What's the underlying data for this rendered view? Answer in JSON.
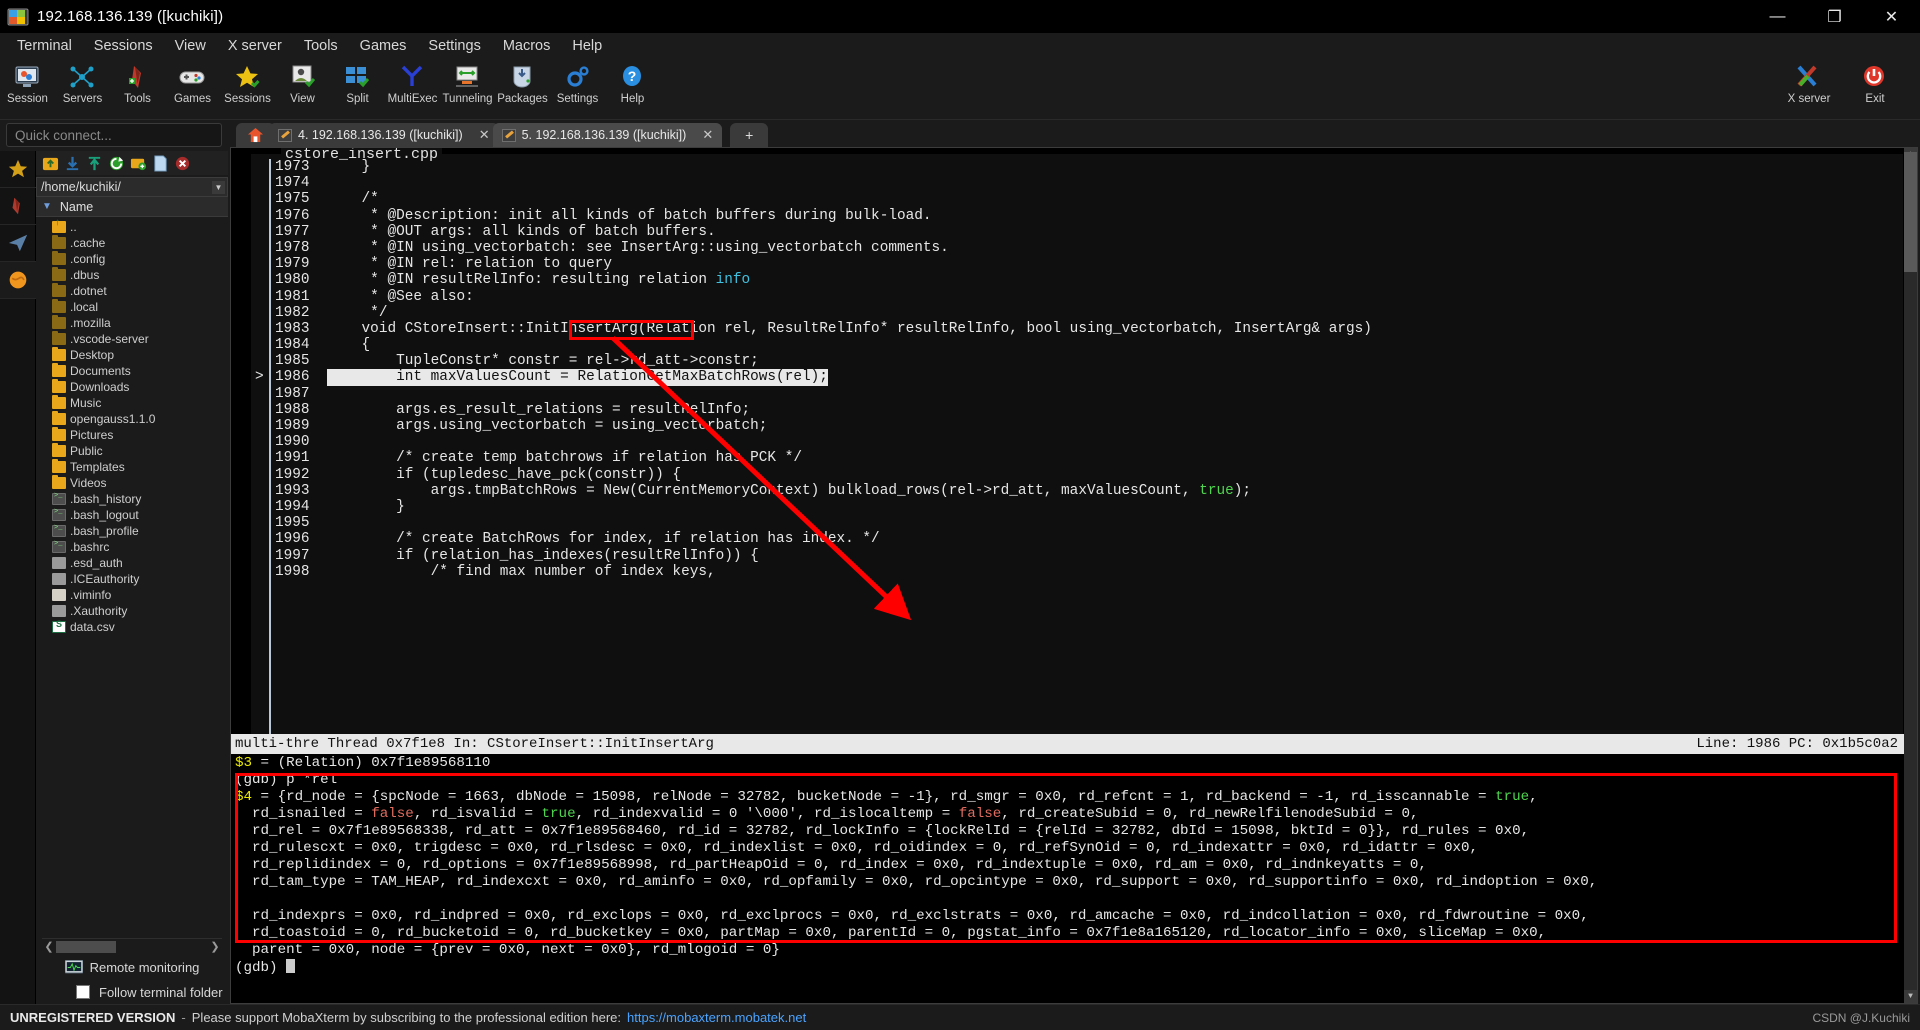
{
  "window": {
    "title": "192.168.136.139 ([kuchiki])",
    "app_icon": "mobaxterm-icon",
    "minimize": "—",
    "maximize": "❐",
    "close": "✕"
  },
  "menubar": [
    "Terminal",
    "Sessions",
    "View",
    "X server",
    "Tools",
    "Games",
    "Settings",
    "Macros",
    "Help"
  ],
  "toolbar": {
    "left": [
      {
        "label": "Session",
        "icon": "session-icon"
      },
      {
        "label": "Servers",
        "icon": "servers-icon"
      },
      {
        "label": "Tools",
        "icon": "tools-icon"
      },
      {
        "label": "Games",
        "icon": "games-icon"
      },
      {
        "label": "Sessions",
        "icon": "sessions-star-icon"
      },
      {
        "label": "View",
        "icon": "view-icon"
      },
      {
        "label": "Split",
        "icon": "split-icon"
      },
      {
        "label": "MultiExec",
        "icon": "multiexec-icon"
      },
      {
        "label": "Tunneling",
        "icon": "tunneling-icon"
      },
      {
        "label": "Packages",
        "icon": "packages-icon"
      },
      {
        "label": "Settings",
        "icon": "settings-gear-icon"
      },
      {
        "label": "Help",
        "icon": "help-icon"
      }
    ],
    "right": [
      {
        "label": "X server",
        "icon": "x-server-icon"
      },
      {
        "label": "Exit",
        "icon": "power-exit-icon"
      }
    ]
  },
  "sidebar": {
    "quick_connect_placeholder": "Quick connect...",
    "vertical_tabs": [
      "favorites-star-icon",
      "tools-knife-icon",
      "sftp-plane-icon",
      "macros-globe-icon"
    ],
    "file_tools": [
      "parent-folder-icon",
      "download-icon",
      "upload-icon",
      "refresh-icon",
      "new-folder-icon",
      "new-file-icon",
      "delete-icon"
    ],
    "path": "/home/kuchiki/",
    "column_header": "Name",
    "sort_icon": "sort-desc-icon",
    "files": [
      {
        "name": "..",
        "kind": "up"
      },
      {
        "name": ".cache",
        "kind": "folder-dim"
      },
      {
        "name": ".config",
        "kind": "folder-dim"
      },
      {
        "name": ".dbus",
        "kind": "folder-dim"
      },
      {
        "name": ".dotnet",
        "kind": "folder-dim"
      },
      {
        "name": ".local",
        "kind": "folder-dim"
      },
      {
        "name": ".mozilla",
        "kind": "folder-dim"
      },
      {
        "name": ".vscode-server",
        "kind": "folder-dim"
      },
      {
        "name": "Desktop",
        "kind": "folder"
      },
      {
        "name": "Documents",
        "kind": "folder"
      },
      {
        "name": "Downloads",
        "kind": "folder"
      },
      {
        "name": "Music",
        "kind": "folder"
      },
      {
        "name": "opengauss1.1.0",
        "kind": "folder"
      },
      {
        "name": "Pictures",
        "kind": "folder"
      },
      {
        "name": "Public",
        "kind": "folder"
      },
      {
        "name": "Templates",
        "kind": "folder"
      },
      {
        "name": "Videos",
        "kind": "folder"
      },
      {
        "name": ".bash_history",
        "kind": "term"
      },
      {
        "name": ".bash_logout",
        "kind": "term"
      },
      {
        "name": ".bash_profile",
        "kind": "term"
      },
      {
        "name": ".bashrc",
        "kind": "term"
      },
      {
        "name": ".esd_auth",
        "kind": "doc"
      },
      {
        "name": ".ICEauthority",
        "kind": "doc"
      },
      {
        "name": ".viminfo",
        "kind": "viminfo"
      },
      {
        "name": ".Xauthority",
        "kind": "doc"
      },
      {
        "name": "data.csv",
        "kind": "csv"
      }
    ],
    "remote_monitoring": "Remote monitoring",
    "follow_terminal_folder": "Follow terminal folder",
    "follow_checked": false
  },
  "tabs": {
    "home_icon": "home-icon",
    "items": [
      {
        "label": "4. 192.168.136.139 ([kuchiki])",
        "active": false,
        "close": "✕"
      },
      {
        "label": "5. 192.168.136.139 ([kuchiki])",
        "active": true,
        "close": "✕"
      }
    ],
    "new_tab": "+"
  },
  "editor": {
    "filename": "cstore_insert.cpp",
    "current_line": 1986,
    "lines": [
      {
        "n": "1973",
        "text": "    }"
      },
      {
        "n": "1974",
        "text": ""
      },
      {
        "n": "1975",
        "text": "    /*"
      },
      {
        "n": "1976",
        "text": "     * @Description: init all kinds of batch buffers during bulk-load."
      },
      {
        "n": "1977",
        "text": "     * @OUT args: all kinds of batch buffers."
      },
      {
        "n": "1978",
        "text": "     * @IN using_vectorbatch: see InsertArg::using_vectorbatch comments."
      },
      {
        "n": "1979",
        "text": "     * @IN rel: relation to query"
      },
      {
        "n": "1980",
        "text": "     * @IN resultRelInfo: resulting relation info",
        "hl": "info"
      },
      {
        "n": "1981",
        "text": "     * @See also:"
      },
      {
        "n": "1982",
        "text": "     */"
      },
      {
        "n": "1983",
        "text": "    void CStoreInsert::InitInsertArg(Relation rel, ResultRelInfo* resultRelInfo, bool using_vectorbatch, InsertArg& args)"
      },
      {
        "n": "1984",
        "text": "    {"
      },
      {
        "n": "1985",
        "text": "        TupleConstr* constr = rel->rd_att->constr;"
      },
      {
        "n": "1986",
        "text": "        int maxValuesCount = RelationGetMaxBatchRows(rel);",
        "current": true
      },
      {
        "n": "1987",
        "text": ""
      },
      {
        "n": "1988",
        "text": "        args.es_result_relations = resultRelInfo;"
      },
      {
        "n": "1989",
        "text": "        args.using_vectorbatch = using_vectorbatch;"
      },
      {
        "n": "1990",
        "text": ""
      },
      {
        "n": "1991",
        "text": "        /* create temp batchrows if relation has PCK */"
      },
      {
        "n": "1992",
        "text": "        if (tupledesc_have_pck(constr)) {"
      },
      {
        "n": "1993",
        "text": "            args.tmpBatchRows = New(CurrentMemoryContext) bulkload_rows(rel->rd_att, maxValuesCount, true);",
        "hl": "true"
      },
      {
        "n": "1994",
        "text": "        }"
      },
      {
        "n": "1995",
        "text": ""
      },
      {
        "n": "1996",
        "text": "        /* create BatchRows for index, if relation has index. */"
      },
      {
        "n": "1997",
        "text": "        if (relation_has_indexes(resultRelInfo)) {"
      },
      {
        "n": "1998",
        "text": "            /* find max number of index keys,"
      }
    ],
    "annotation_highlight_text": "(Relation rel,"
  },
  "status_line": {
    "left": "multi-thre Thread 0x7f1e8 In: CStoreInsert::InitInsertArg",
    "right": "Line: 1986 PC: 0x1b5c0a2"
  },
  "gdb": {
    "lines": [
      {
        "segs": [
          {
            "t": "$3",
            "c": "yellow"
          },
          {
            "t": " = (Relation) 0x7f1e89568110"
          }
        ]
      },
      {
        "segs": [
          {
            "t": "(gdb) p *rel"
          }
        ]
      },
      {
        "segs": [
          {
            "t": "$4",
            "c": "yellow"
          },
          {
            "t": " = {rd_node = {spcNode = 1663, dbNode = 15098, relNode = 32782, bucketNode = -1}, rd_smgr = 0x0, rd_refcnt = 1, rd_backend = -1, rd_isscannable = "
          },
          {
            "t": "true",
            "c": "green"
          },
          {
            "t": ","
          }
        ]
      },
      {
        "segs": [
          {
            "t": "  rd_isnailed = "
          },
          {
            "t": "false",
            "c": "red"
          },
          {
            "t": ", rd_isvalid = "
          },
          {
            "t": "true",
            "c": "green"
          },
          {
            "t": ", rd_indexvalid = 0 '\\000', rd_islocaltemp = "
          },
          {
            "t": "false",
            "c": "red"
          },
          {
            "t": ", rd_createSubid = 0, rd_newRelfilenodeSubid = 0,"
          }
        ]
      },
      {
        "segs": [
          {
            "t": "  rd_rel = 0x7f1e89568338, rd_att = 0x7f1e89568460, rd_id = 32782, rd_lockInfo = {lockRelId = {relId = 32782, dbId = 15098, bktId = 0}}, rd_rules = 0x0,"
          }
        ]
      },
      {
        "segs": [
          {
            "t": "  rd_rulescxt = 0x0, trigdesc = 0x0, rd_rlsdesc = 0x0, rd_indexlist = 0x0, rd_oidindex = 0, rd_refSynOid = 0, rd_indexattr = 0x0, rd_idattr = 0x0,"
          }
        ]
      },
      {
        "segs": [
          {
            "t": "  rd_replidindex = 0, rd_options = 0x7f1e89568998, rd_partHeapOid = 0, rd_index = 0x0, rd_indextuple = 0x0, rd_am = 0x0, rd_indnkeyatts = 0,"
          }
        ]
      },
      {
        "segs": [
          {
            "t": "  rd_tam_type = TAM_HEAP, rd_indexcxt = 0x0, rd_aminfo = 0x0, rd_opfamily = 0x0, rd_opcintype = 0x0, rd_support = 0x0, rd_supportinfo = 0x0, rd_indoption = 0x0,"
          }
        ]
      },
      {
        "segs": [
          {
            "t": ""
          }
        ]
      },
      {
        "segs": [
          {
            "t": "  rd_indexprs = 0x0, rd_indpred = 0x0, rd_exclops = 0x0, rd_exclprocs = 0x0, rd_exclstrats = 0x0, rd_amcache = 0x0, rd_indcollation = 0x0, rd_fdwroutine = 0x0,"
          }
        ]
      },
      {
        "segs": [
          {
            "t": "  rd_toastoid = 0, rd_bucketoid = 0, rd_bucketkey = 0x0, partMap = 0x0, parentId = 0, pgstat_info = 0x7f1e8a165120, rd_locator_info = 0x0, sliceMap = 0x0,"
          }
        ]
      },
      {
        "segs": [
          {
            "t": "  parent = 0x0, node = {prev = 0x0, next = 0x0}, rd_mlogoid = 0}"
          }
        ]
      },
      {
        "segs": [
          {
            "t": "(gdb) ",
            "cursor": true
          }
        ]
      }
    ]
  },
  "bottom_bar": {
    "unregistered": "UNREGISTERED VERSION",
    "separator": "-",
    "message": "Please support MobaXterm by subscribing to the professional edition here:",
    "link": "https://mobaxterm.mobatek.net",
    "watermark": "CSDN @J.Kuchiki"
  },
  "colors": {
    "accent_blue": "#2a7fd4",
    "red_annotation": "#ff0000",
    "window_bg": "#1b1b1b",
    "terminal_bg": "#000000"
  }
}
